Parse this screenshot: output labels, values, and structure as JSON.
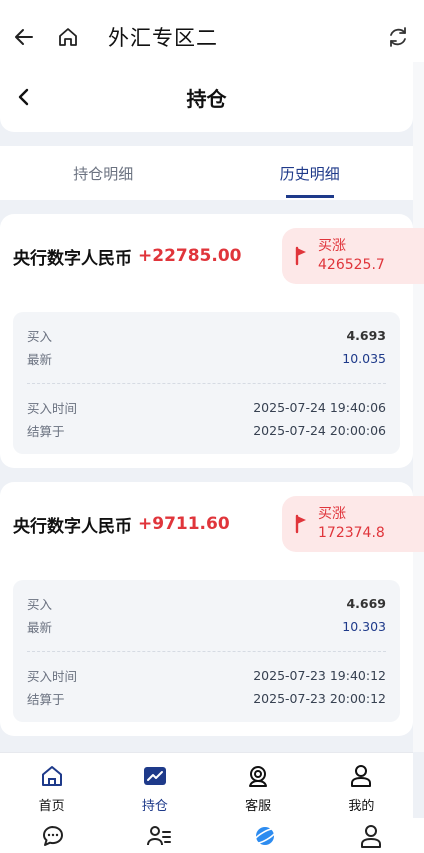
{
  "browser": {
    "title": "外汇专区二"
  },
  "page": {
    "title": "持仓"
  },
  "tabs": [
    {
      "label": "持仓明细",
      "active": false
    },
    {
      "label": "历史明细",
      "active": true
    }
  ],
  "positions": [
    {
      "name": "央行数字人民币",
      "pnl": "+22785.00",
      "direction": "买涨",
      "amount": "426525.7",
      "buy_label": "买入",
      "buy_price": "4.693",
      "latest_label": "最新",
      "latest_price": "10.035",
      "buy_time_label": "买入时间",
      "buy_time": "2025-07-24 19:40:06",
      "settle_label": "结算于",
      "settle_time": "2025-07-24 20:00:06"
    },
    {
      "name": "央行数字人民币",
      "pnl": "+9711.60",
      "direction": "买涨",
      "amount": "172374.8",
      "buy_label": "买入",
      "buy_price": "4.669",
      "latest_label": "最新",
      "latest_price": "10.303",
      "buy_time_label": "买入时间",
      "buy_time": "2025-07-23 19:40:12",
      "settle_label": "结算于",
      "settle_time": "2025-07-23 20:00:12"
    }
  ],
  "tabbar": [
    {
      "label": "首页",
      "icon": "home-icon"
    },
    {
      "label": "持仓",
      "icon": "chart-icon",
      "active": true
    },
    {
      "label": "客服",
      "icon": "support-icon"
    },
    {
      "label": "我的",
      "icon": "user-icon"
    }
  ],
  "colors": {
    "accent": "#1e3a8a",
    "up": "#e0353b",
    "badge_bg": "#fde8e8"
  }
}
